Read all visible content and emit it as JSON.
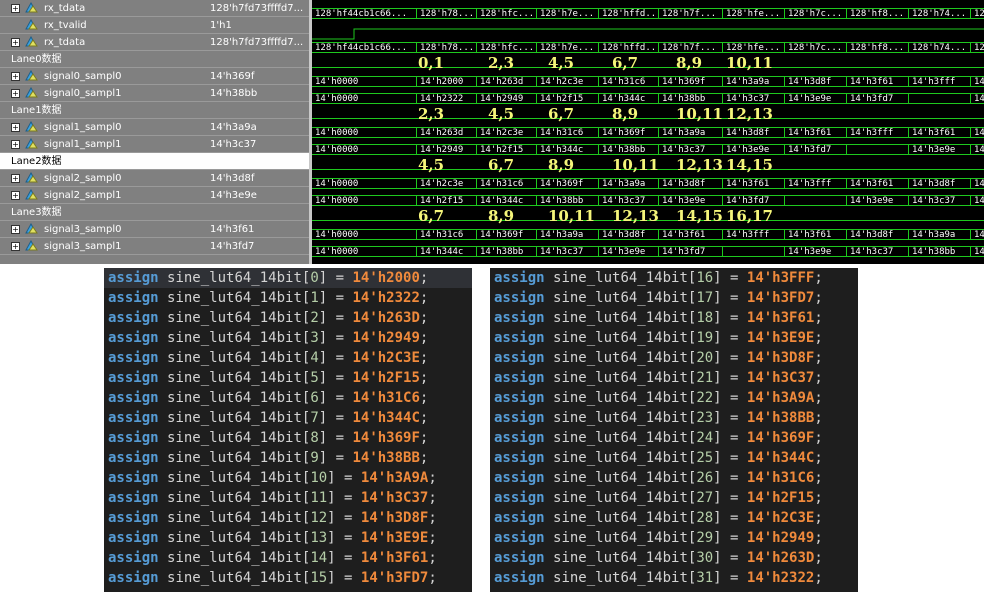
{
  "waveform": {
    "rows": [
      {
        "type": "signal",
        "name": "rx_tdata",
        "value": "128'h7fd73ffffd7...",
        "expand": true,
        "kind": "bus",
        "segments": [
          "128'hf44cb1c66...",
          "128'h78...",
          "128'hfc...",
          "128'h7e...",
          "128'hffd...",
          "128'h7f...",
          "128'hfe...",
          "128'h7c...",
          "128'hf8...",
          "128'h74...",
          "128"
        ]
      },
      {
        "type": "signal",
        "name": "rx_tvalid",
        "value": "1'h1",
        "expand": false,
        "kind": "bit"
      },
      {
        "type": "signal",
        "name": "rx_tdata",
        "value": "128'h7fd73ffffd7...",
        "expand": true,
        "kind": "bus",
        "segments": [
          "128'hf44cb1c66...",
          "128'h78...",
          "128'hfc...",
          "128'h7e...",
          "128'hffd...",
          "128'h7f...",
          "128'hfe...",
          "128'h7c...",
          "128'hf8...",
          "128'h74...",
          "128"
        ]
      },
      {
        "type": "group",
        "name": "Lane0数据",
        "annotations": [
          "0,1",
          "2,3",
          "4,5",
          "6,7",
          "8,9",
          "10,11"
        ]
      },
      {
        "type": "signal",
        "name": "signal0_sampl0",
        "value": "14'h369f",
        "expand": true,
        "kind": "bus",
        "segments": [
          "14'h0000",
          "14'h2000",
          "14'h263d",
          "14'h2c3e",
          "14'h31c6",
          "14'h369f",
          "14'h3a9a",
          "14'h3d8f",
          "14'h3f61",
          "14'h3fff",
          "14"
        ]
      },
      {
        "type": "signal",
        "name": "signal0_sampl1",
        "value": "14'h38bb",
        "expand": true,
        "kind": "bus",
        "segments": [
          "14'h0000",
          "14'h2322",
          "14'h2949",
          "14'h2f15",
          "14'h344c",
          "14'h38bb",
          "14'h3c37",
          "14'h3e9e",
          "14'h3fd7",
          "",
          "14"
        ]
      },
      {
        "type": "group",
        "name": "Lane1数据",
        "annotations": [
          "2,3",
          "4,5",
          "6,7",
          "8,9",
          "10,11",
          "12,13"
        ]
      },
      {
        "type": "signal",
        "name": "signal1_sampl0",
        "value": "14'h3a9a",
        "expand": true,
        "kind": "bus",
        "segments": [
          "14'h0000",
          "14'h263d",
          "14'h2c3e",
          "14'h31c6",
          "14'h369f",
          "14'h3a9a",
          "14'h3d8f",
          "14'h3f61",
          "14'h3fff",
          "14'h3f61",
          "14"
        ]
      },
      {
        "type": "signal",
        "name": "signal1_sampl1",
        "value": "14'h3c37",
        "expand": true,
        "kind": "bus",
        "segments": [
          "14'h0000",
          "14'h2949",
          "14'h2f15",
          "14'h344c",
          "14'h38bb",
          "14'h3c37",
          "14'h3e9e",
          "14'h3fd7",
          "",
          "14'h3e9e",
          "14"
        ]
      },
      {
        "type": "group",
        "name": "Lane2数据",
        "selected": true,
        "annotations": [
          "4,5",
          "6,7",
          "8,9",
          "10,11",
          "12,13",
          "14,15"
        ]
      },
      {
        "type": "signal",
        "name": "signal2_sampl0",
        "value": "14'h3d8f",
        "expand": true,
        "kind": "bus",
        "segments": [
          "14'h0000",
          "14'h2c3e",
          "14'h31c6",
          "14'h369f",
          "14'h3a9a",
          "14'h3d8f",
          "14'h3f61",
          "14'h3fff",
          "14'h3f61",
          "14'h3d8f",
          "14"
        ]
      },
      {
        "type": "signal",
        "name": "signal2_sampl1",
        "value": "14'h3e9e",
        "expand": true,
        "kind": "bus",
        "segments": [
          "14'h0000",
          "14'h2f15",
          "14'h344c",
          "14'h38bb",
          "14'h3c37",
          "14'h3e9e",
          "14'h3fd7",
          "",
          "14'h3e9e",
          "14'h3c37",
          "14"
        ]
      },
      {
        "type": "group",
        "name": "Lane3数据",
        "annotations": [
          "6,7",
          "8,9",
          "10,11",
          "12,13",
          "14,15",
          "16,17"
        ]
      },
      {
        "type": "signal",
        "name": "signal3_sampl0",
        "value": "14'h3f61",
        "expand": true,
        "kind": "bus",
        "segments": [
          "14'h0000",
          "14'h31c6",
          "14'h369f",
          "14'h3a9a",
          "14'h3d8f",
          "14'h3f61",
          "14'h3fff",
          "14'h3f61",
          "14'h3d8f",
          "14'h3a9a",
          "14"
        ]
      },
      {
        "type": "signal",
        "name": "signal3_sampl1",
        "value": "14'h3fd7",
        "expand": true,
        "kind": "bus",
        "segments": [
          "14'h0000",
          "14'h344c",
          "14'h38bb",
          "14'h3c37",
          "14'h3e9e",
          "14'h3fd7",
          "",
          "14'h3e9e",
          "14'h3c37",
          "14'h38bb",
          "14"
        ]
      }
    ]
  },
  "code_left": {
    "keyword": "assign",
    "name": "sine_lut64_14bit",
    "lines": [
      {
        "index": "0",
        "value": "14'h2000"
      },
      {
        "index": "1",
        "value": "14'h2322"
      },
      {
        "index": "2",
        "value": "14'h263D"
      },
      {
        "index": "3",
        "value": "14'h2949"
      },
      {
        "index": "4",
        "value": "14'h2C3E"
      },
      {
        "index": "5",
        "value": "14'h2F15"
      },
      {
        "index": "6",
        "value": "14'h31C6"
      },
      {
        "index": "7",
        "value": "14'h344C"
      },
      {
        "index": "8",
        "value": "14'h369F"
      },
      {
        "index": "9",
        "value": "14'h38BB"
      },
      {
        "index": "10",
        "value": "14'h3A9A"
      },
      {
        "index": "11",
        "value": "14'h3C37"
      },
      {
        "index": "12",
        "value": "14'h3D8F"
      },
      {
        "index": "13",
        "value": "14'h3E9E"
      },
      {
        "index": "14",
        "value": "14'h3F61"
      },
      {
        "index": "15",
        "value": "14'h3FD7"
      }
    ]
  },
  "code_right": {
    "keyword": "assign",
    "name": "sine_lut64_14bit",
    "lines": [
      {
        "index": "16",
        "value": "14'h3FFF"
      },
      {
        "index": "17",
        "value": "14'h3FD7"
      },
      {
        "index": "18",
        "value": "14'h3F61"
      },
      {
        "index": "19",
        "value": "14'h3E9E"
      },
      {
        "index": "20",
        "value": "14'h3D8F"
      },
      {
        "index": "21",
        "value": "14'h3C37"
      },
      {
        "index": "22",
        "value": "14'h3A9A"
      },
      {
        "index": "23",
        "value": "14'h38BB"
      },
      {
        "index": "24",
        "value": "14'h369F"
      },
      {
        "index": "25",
        "value": "14'h344C"
      },
      {
        "index": "26",
        "value": "14'h31C6"
      },
      {
        "index": "27",
        "value": "14'h2F15"
      },
      {
        "index": "28",
        "value": "14'h2C3E"
      },
      {
        "index": "29",
        "value": "14'h2949"
      },
      {
        "index": "30",
        "value": "14'h263D"
      },
      {
        "index": "31",
        "value": "14'h2322"
      }
    ]
  },
  "colors": {
    "trace": "#1ec81e",
    "annotation": "#f5f57a",
    "keyword": "#569cd6",
    "literal": "#f08a3c"
  }
}
